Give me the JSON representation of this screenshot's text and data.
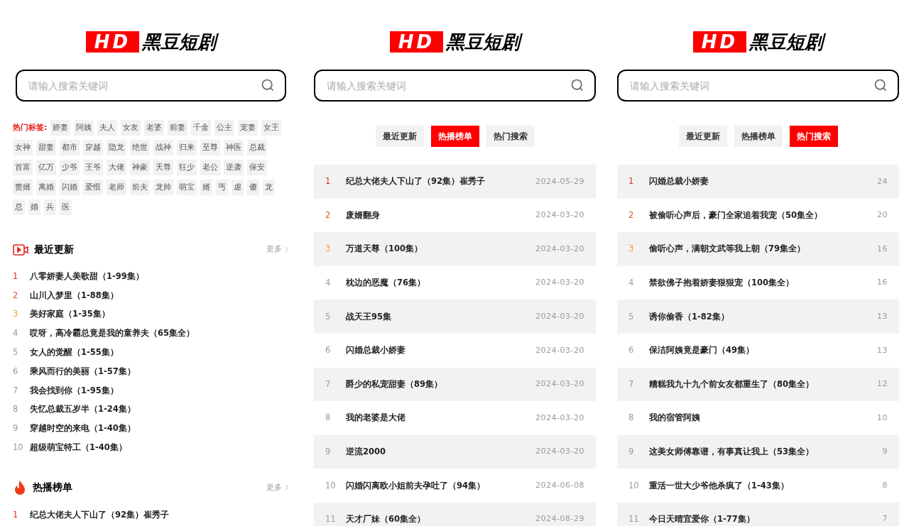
{
  "panels": [
    {
      "kind": "home",
      "logo": {
        "badge": "HD",
        "name": "黑豆短剧"
      },
      "search": {
        "placeholder": "请输入搜索关键词"
      },
      "hot_tags": {
        "label": "热门标签:",
        "tags": [
          "娇妻",
          "阿姨",
          "夫人",
          "女友",
          "老婆",
          "前妻",
          "千金",
          "公主",
          "宠妻",
          "女王",
          "女神",
          "甜妻",
          "都市",
          "穿越",
          "隐龙",
          "绝世",
          "战神",
          "归来",
          "至尊",
          "神医",
          "总裁",
          "首富",
          "亿万",
          "少爷",
          "王爷",
          "大佬",
          "神豪",
          "天尊",
          "狂少",
          "老公",
          "逆袭",
          "保安",
          "赘婿",
          "离婚",
          "闪婚",
          "爱恨",
          "老师",
          "前夫",
          "龙帅",
          "萌宝",
          "婿",
          "丐",
          "虐",
          "傻",
          "龙",
          "总",
          "婚",
          "兵",
          "医"
        ]
      },
      "sections": [
        {
          "kind": "recent",
          "title": "最近更新",
          "more": "更多",
          "items": [
            {
              "rank": "1",
              "title": "八零娇妻人美歌甜（1-99集）"
            },
            {
              "rank": "2",
              "title": "山川入梦里（1-88集）"
            },
            {
              "rank": "3",
              "title": "美好家庭（1-35集）"
            },
            {
              "rank": "4",
              "title": "哎呀，高冷霸总竟是我的童养夫（65集全）"
            },
            {
              "rank": "5",
              "title": "女人的觉醒（1-55集）"
            },
            {
              "rank": "6",
              "title": "乘风而行的美丽（1-57集）"
            },
            {
              "rank": "7",
              "title": "我会找到你（1-95集）"
            },
            {
              "rank": "8",
              "title": "失忆总裁五岁半（1-24集）"
            },
            {
              "rank": "9",
              "title": "穿越时空的来电（1-40集）"
            },
            {
              "rank": "10",
              "title": "超级萌宝特工（1-40集）"
            }
          ]
        },
        {
          "kind": "hot",
          "title": "热播榜单",
          "more": "更多",
          "items": [
            {
              "rank": "1",
              "title": "纪总大佬夫人下山了（92集）崔秀子"
            }
          ]
        }
      ]
    },
    {
      "kind": "ranking",
      "logo": {
        "badge": "HD",
        "name": "黑豆短剧"
      },
      "search": {
        "placeholder": "请输入搜索关键词"
      },
      "tabs": [
        {
          "label": "最近更新",
          "selected": false
        },
        {
          "label": "热播榜单",
          "selected": true
        },
        {
          "label": "热门搜索",
          "selected": false
        }
      ],
      "rows": [
        {
          "rank": "1",
          "title": "纪总大佬夫人下山了（92集）崔秀子",
          "meta": "2024-05-29"
        },
        {
          "rank": "2",
          "title": "废婿翻身",
          "meta": "2024-03-20"
        },
        {
          "rank": "3",
          "title": "万道天尊（100集）",
          "meta": "2024-03-20"
        },
        {
          "rank": "4",
          "title": "枕边的恶魔（76集）",
          "meta": "2024-03-20"
        },
        {
          "rank": "5",
          "title": "战天王95集",
          "meta": "2024-03-20"
        },
        {
          "rank": "6",
          "title": "闪婚总裁小娇妻",
          "meta": "2024-03-20"
        },
        {
          "rank": "7",
          "title": "爵少的私宠甜妻（89集）",
          "meta": "2024-03-20"
        },
        {
          "rank": "8",
          "title": "我的老婆是大佬",
          "meta": "2024-03-20"
        },
        {
          "rank": "9",
          "title": "逆流2000",
          "meta": "2024-03-20"
        },
        {
          "rank": "10",
          "title": "闪婚闪离欧小姐前夫孕吐了（94集）",
          "meta": "2024-06-08"
        },
        {
          "rank": "11",
          "title": "天才厂妹（60集全）",
          "meta": "2024-08-29"
        }
      ]
    },
    {
      "kind": "ranking",
      "logo": {
        "badge": "HD",
        "name": "黑豆短剧"
      },
      "search": {
        "placeholder": "请输入搜索关键词"
      },
      "tabs": [
        {
          "label": "最近更新",
          "selected": false
        },
        {
          "label": "热播榜单",
          "selected": false
        },
        {
          "label": "热门搜索",
          "selected": true
        }
      ],
      "rows": [
        {
          "rank": "1",
          "title": "闪婚总裁小娇妻",
          "meta": "24"
        },
        {
          "rank": "2",
          "title": "被偷听心声后，豪门全家追着我宠（50集全）",
          "meta": "20"
        },
        {
          "rank": "3",
          "title": "偷听心声，满朝文武等我上朝（79集全）",
          "meta": "16"
        },
        {
          "rank": "4",
          "title": "禁欲佛子抱着娇妻狠狠宠（100集全）",
          "meta": "16"
        },
        {
          "rank": "5",
          "title": "诱你偷香（1-82集）",
          "meta": "13"
        },
        {
          "rank": "6",
          "title": "保洁阿姨竟是豪门（49集）",
          "meta": "13"
        },
        {
          "rank": "7",
          "title": "糟糕我九十九个前女友都重生了（80集全）",
          "meta": "12"
        },
        {
          "rank": "8",
          "title": "我的宿管阿姨",
          "meta": "10"
        },
        {
          "rank": "9",
          "title": "这美女师傅靠谱，有事真让我上（53集全）",
          "meta": "9"
        },
        {
          "rank": "10",
          "title": "重活一世大少爷他杀疯了（1-43集）",
          "meta": "8"
        },
        {
          "rank": "11",
          "title": "今日天晴宜爱你（1-77集）",
          "meta": "7"
        }
      ]
    }
  ]
}
